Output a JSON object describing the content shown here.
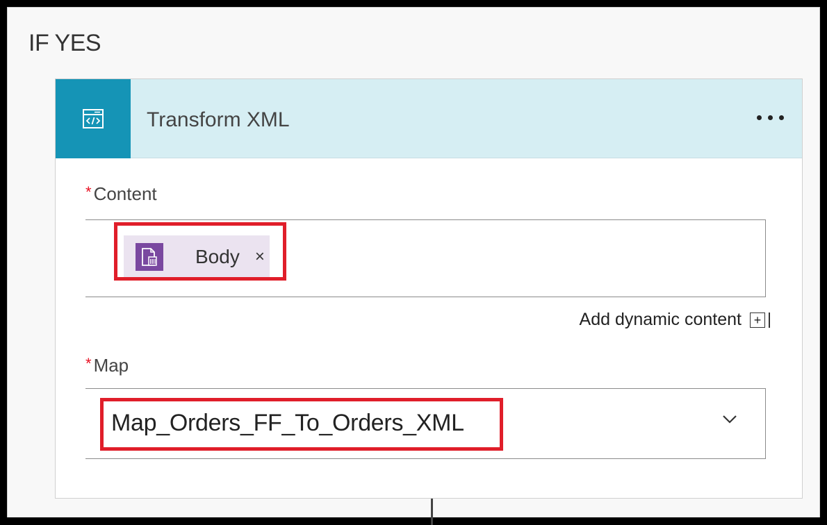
{
  "branch": {
    "label": "IF YES"
  },
  "action": {
    "title": "Transform XML",
    "icon": "code-window-icon",
    "accent_color": "#1594b6",
    "header_bg": "#d6eef3"
  },
  "fields": {
    "content": {
      "required_marker": "*",
      "label": "Content",
      "token": {
        "label": "Body",
        "remove": "×",
        "icon": "body-token-icon",
        "color": "#7a48a0"
      }
    },
    "add_dynamic": {
      "label": "Add dynamic content",
      "icon": "plus-box-icon"
    },
    "map": {
      "required_marker": "*",
      "label": "Map",
      "value": "Map_Orders_FF_To_Orders_XML",
      "icon": "chevron-down-icon"
    }
  },
  "highlight_color": "#e01e2a"
}
